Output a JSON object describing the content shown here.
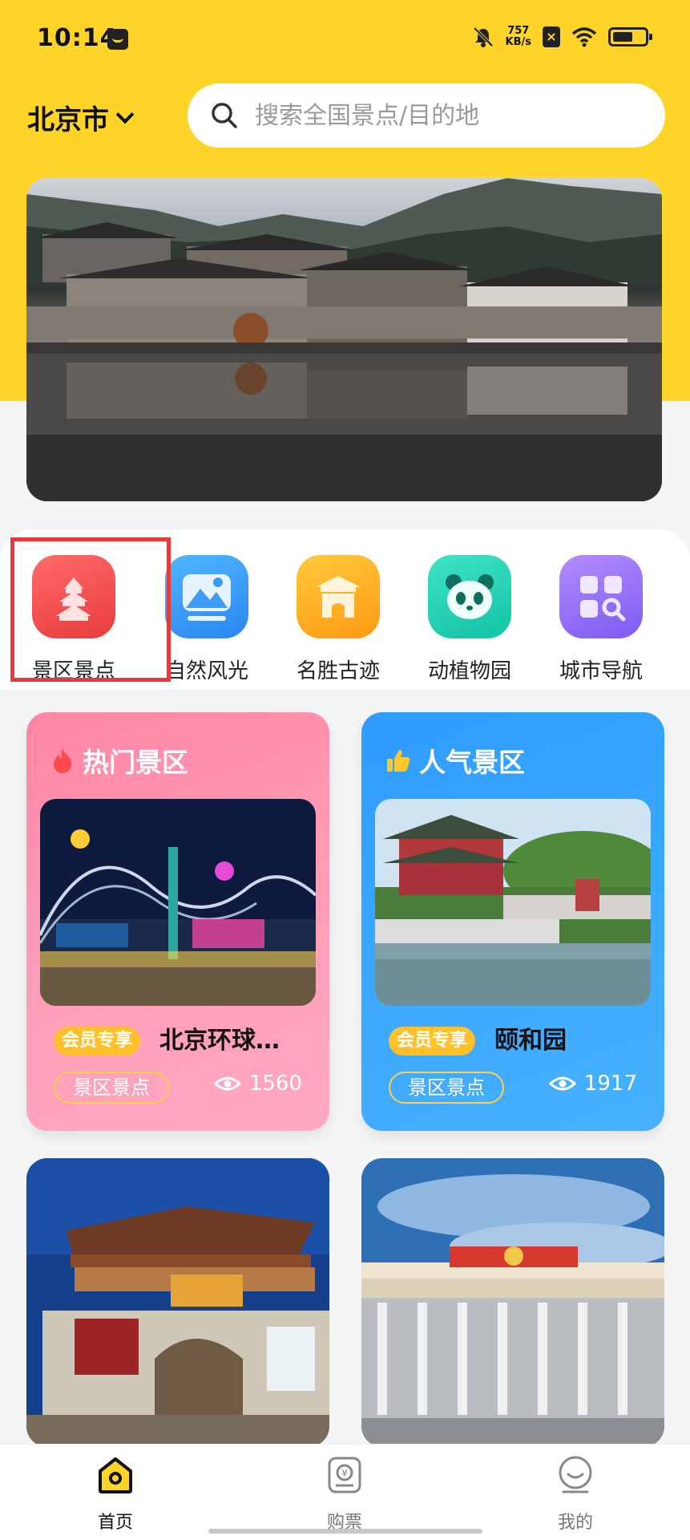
{
  "status_bar": {
    "time": "10:14",
    "net_speed_value": "757",
    "net_speed_unit": "KB/s"
  },
  "header": {
    "city": "北京市",
    "search_placeholder": "搜索全国景点/目的地"
  },
  "categories": [
    {
      "label": "景区景点",
      "icon": "temple-icon",
      "color": "#f24a4a"
    },
    {
      "label": "自然风光",
      "icon": "mountain-icon",
      "color": "#2a8cf0"
    },
    {
      "label": "名胜古迹",
      "icon": "gate-icon",
      "color": "#ffa51e"
    },
    {
      "label": "动植物园",
      "icon": "panda-icon",
      "color": "#20d1b0"
    },
    {
      "label": "城市导航",
      "icon": "grid-search-icon",
      "color": "#9070f0"
    }
  ],
  "cards": [
    {
      "title": "热门景区",
      "badge": "会员专享",
      "name": "北京环球…",
      "tag": "景区景点",
      "views": "1560"
    },
    {
      "title": "人气景区",
      "badge": "会员专享",
      "name": "颐和园",
      "tag": "景区景点",
      "views": "1917"
    }
  ],
  "tabbar": [
    {
      "label": "首页",
      "icon": "home-icon",
      "active": true
    },
    {
      "label": "购票",
      "icon": "ticket-icon",
      "active": false
    },
    {
      "label": "我的",
      "icon": "profile-icon",
      "active": false
    }
  ],
  "colors": {
    "brand_yellow": "#fed428",
    "highlight_red": "#e53b3b"
  }
}
